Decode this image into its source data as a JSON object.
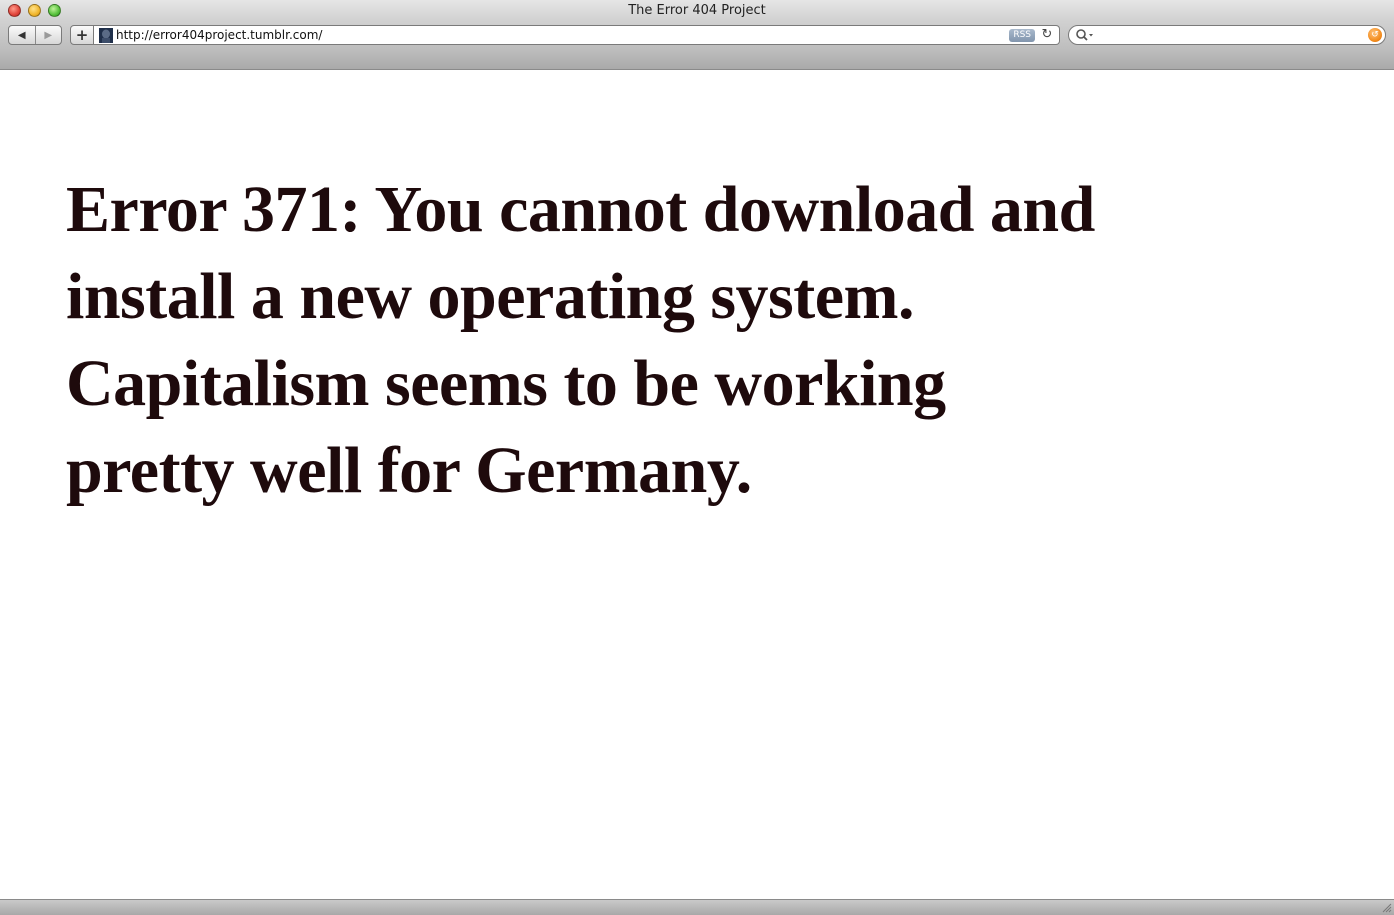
{
  "window": {
    "title": "The Error 404 Project"
  },
  "toolbar": {
    "back_label": "◀",
    "forward_label": "▶",
    "add_bookmark_label": "+",
    "address": {
      "url": "http://error404project.tumblr.com/",
      "rss_label": "RSS",
      "reload_glyph": "↻"
    },
    "search": {
      "value": "",
      "placeholder": ""
    }
  },
  "page": {
    "message_lines": [
      "Error 371: You cannot download and",
      "install a new operating system.",
      "Capitalism seems to be working",
      "pretty well for Germany."
    ]
  },
  "colors": {
    "text": "#1e0a0c",
    "background": "#ffffff",
    "close": "#e0443a",
    "minimize": "#f0b52c",
    "zoom": "#56c13b",
    "snapback": "#f28a1a"
  }
}
